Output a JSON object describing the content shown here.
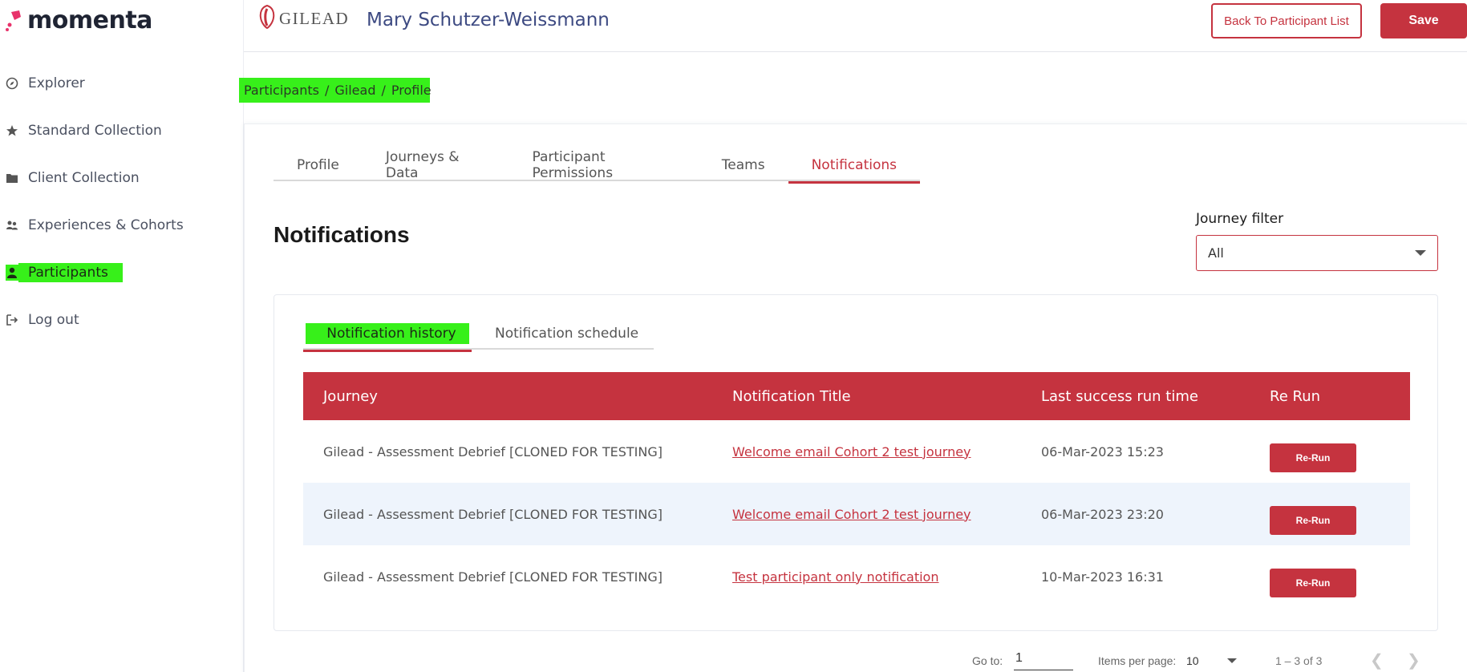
{
  "app": {
    "logo_text": "momenta"
  },
  "sidebar": {
    "items": [
      {
        "label": "Explorer",
        "icon": "compass-icon"
      },
      {
        "label": "Standard Collection",
        "icon": "star-icon"
      },
      {
        "label": "Client Collection",
        "icon": "folder-icon"
      },
      {
        "label": "Experiences & Cohorts",
        "icon": "users-icon"
      },
      {
        "label": "Participants",
        "icon": "user-icon",
        "active": true
      },
      {
        "label": "Log out",
        "icon": "logout-icon"
      }
    ]
  },
  "header": {
    "brand": "GILEAD",
    "participant_name": "Mary Schutzer-Weissmann",
    "back_button": "Back To Participant List",
    "save_button": "Save"
  },
  "breadcrumb": [
    "Participants",
    "Gilead",
    "Profile"
  ],
  "tabs": [
    {
      "label": "Profile"
    },
    {
      "label": "Journeys & Data"
    },
    {
      "label": "Participant Permissions"
    },
    {
      "label": "Teams"
    },
    {
      "label": "Notifications",
      "active": true
    }
  ],
  "section": {
    "title": "Notifications"
  },
  "journey_filter": {
    "label": "Journey filter",
    "value": "All"
  },
  "subtabs": [
    {
      "label": "Notification history",
      "active": true
    },
    {
      "label": "Notification schedule"
    }
  ],
  "table": {
    "columns": [
      "Journey",
      "Notification Title",
      "Last success run time",
      "Re Run"
    ],
    "rows": [
      {
        "journey": "Gilead - Assessment Debrief [CLONED FOR TESTING]",
        "title": "Welcome email Cohort 2 test journey",
        "time": "06-Mar-2023 15:23",
        "action": "Re-Run"
      },
      {
        "journey": "Gilead - Assessment Debrief [CLONED FOR TESTING]",
        "title": "Welcome email Cohort 2 test journey",
        "time": "06-Mar-2023 23:20",
        "action": "Re-Run"
      },
      {
        "journey": "Gilead - Assessment Debrief [CLONED FOR TESTING]",
        "title": "Test participant only notification",
        "time": "10-Mar-2023 16:31",
        "action": "Re-Run"
      }
    ]
  },
  "pagination": {
    "goto_label": "Go to:",
    "goto_value": "1",
    "items_per_page_label": "Items per page:",
    "items_per_page": "10",
    "range": "1 – 3 of 3"
  },
  "colors": {
    "accent": "#c5333f",
    "highlight": "#37f01a",
    "name": "#3d4a82"
  }
}
